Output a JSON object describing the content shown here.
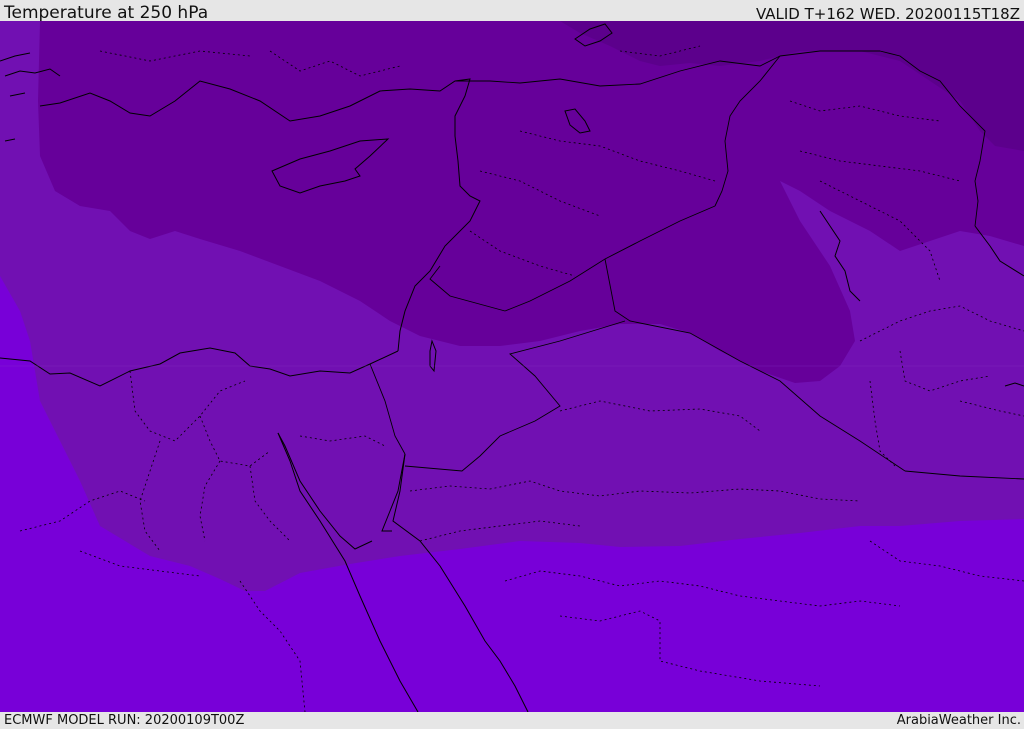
{
  "header": {
    "title": "Temperature at 250 hPa",
    "valid": "VALID T+162 WED. 20200115T18Z"
  },
  "footer": {
    "model_run": "ECMWF MODEL RUN: 20200109T00Z",
    "credit": "ArabiaWeather Inc."
  },
  "map": {
    "field": "temperature",
    "level": "250 hPa",
    "region": "Eastern Mediterranean / Middle East",
    "colors": {
      "band_warm": "#7800d8",
      "band_mid": "#7110b2",
      "band_cold": "#66009a",
      "band_coldest": "#5c008c",
      "coastline": "#000000",
      "border": "#000000"
    }
  }
}
